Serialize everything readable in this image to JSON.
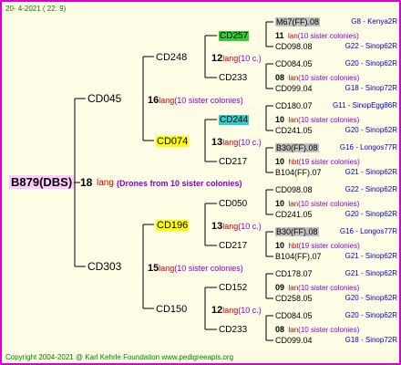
{
  "header": {
    "date": "20-  4-2021 ( 22:  9)"
  },
  "footer": {
    "copyright": "Copyright 2004-2021 @ Karl Kehrle Foundation   www.pedigreeapis.org"
  },
  "root": {
    "name": "B879(DBS)",
    "num": "18",
    "mark": "lang",
    "drones": "(Drones from 10 sister colonies)"
  },
  "gen1": [
    {
      "name": "CD045"
    },
    {
      "name": "CD303"
    }
  ],
  "gen1_links": [
    {
      "num": "16",
      "mark": "lang",
      "sis": "(10 sister colonies)"
    },
    {
      "num": "15",
      "mark": "lang",
      "sis": "(10 sister colonies)"
    }
  ],
  "gen2": [
    {
      "name": "CD248",
      "num": "12",
      "mark": "lang",
      "sis": "(10 c.)"
    },
    {
      "name": "CD074",
      "num": "13",
      "mark": "lang",
      "sis": "(10 c.)"
    },
    {
      "name": "CD196",
      "num": "13",
      "mark": "lang",
      "sis": "(10 c.)"
    },
    {
      "name": "CD150",
      "num": "12",
      "mark": "lang",
      "sis": "(10 c.)"
    }
  ],
  "gen3": [
    {
      "name": "CD257"
    },
    {
      "name": "CD233"
    },
    {
      "name": "CD244"
    },
    {
      "name": "CD217"
    },
    {
      "name": "CD050"
    },
    {
      "name": "CD217"
    },
    {
      "name": "CD152"
    },
    {
      "name": "CD233"
    }
  ],
  "gen4": [
    {
      "top": "M67(FF).08",
      "src1": "G8 - Kenya2R",
      "num": "11",
      "mark": "lan",
      "sis": "(10 sister colonies)",
      "bot": "CD098.08",
      "src2": "G22 - Sinop62R"
    },
    {
      "top": "CD084.05",
      "src1": "G20 - Sinop62R",
      "num": "08",
      "mark": "lan",
      "sis": "(10 sister colonies)",
      "bot": "CD099.04",
      "src2": "G18 - Sinop72R"
    },
    {
      "top": "CD180.07",
      "src1": "G11 - SinopEgg86R",
      "num": "10",
      "mark": "lan",
      "sis": "(10 sister colonies)",
      "bot": "CD241.05",
      "src2": "G20 - Sinop62R"
    },
    {
      "top": "B30(FF).08",
      "src1": "G16 - Longos77R",
      "num": "10",
      "mark": "hbt",
      "sis": "(19 sister colonies)",
      "bot": "B104(FF).07",
      "src2": "G21 - Sinop62R"
    },
    {
      "top": "CD098.08",
      "src1": "G22 - Sinop62R",
      "num": "10",
      "mark": "lan",
      "sis": "(10 sister colonies)",
      "bot": "CD241.05",
      "src2": "G20 - Sinop62R"
    },
    {
      "top": "B30(FF).08",
      "src1": "G16 - Longos77R",
      "num": "10",
      "mark": "hbt",
      "sis": "(19 sister colonies)",
      "bot": "B104(FF).07",
      "src2": "G21 - Sinop62R"
    },
    {
      "top": "CD178.07",
      "src1": "G21 - Sinop62R",
      "num": "09",
      "mark": "lan",
      "sis": "(10 sister colonies)",
      "bot": "CD258.05",
      "src2": "G20 - Sinop62R"
    },
    {
      "top": "CD084.05",
      "src1": "G20 - Sinop62R",
      "num": "08",
      "mark": "lan",
      "sis": "(10 sister colonies)",
      "bot": "CD099.04",
      "src2": "G18 - Sinop72R"
    }
  ]
}
